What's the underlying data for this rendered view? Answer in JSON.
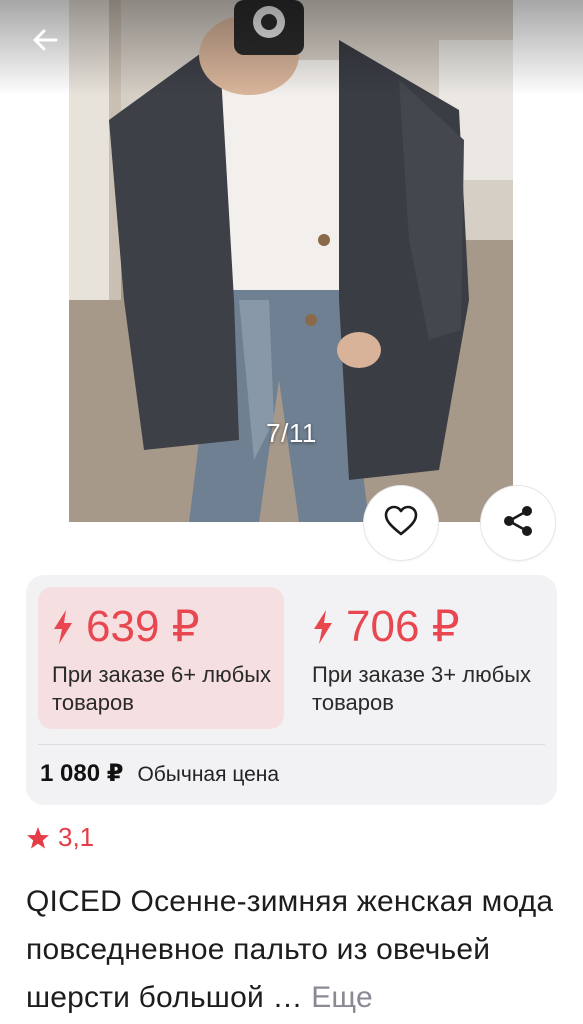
{
  "gallery": {
    "counter": "7/11"
  },
  "price_card": {
    "offers": [
      {
        "price": "639 ₽",
        "note": "При заказе 6+ любых товаров",
        "selected": true
      },
      {
        "price": "706 ₽",
        "note": "При заказе 3+ любых товаров",
        "selected": false
      }
    ],
    "regular_price": "1 080 ₽",
    "regular_label": "Обычная цена"
  },
  "rating": {
    "value": "3,1"
  },
  "product": {
    "title": "QICED Осенне-зимняя женская мода повседневное пальто из овечьей шерсти большой …",
    "more_label": "Еще"
  },
  "icons": {
    "back": "arrow-left-icon",
    "favorite": "heart-icon",
    "share": "share-icon",
    "bolt": "lightning-icon",
    "star": "star-icon"
  },
  "colors": {
    "accent_red": "#e8474f",
    "offer_selected_bg": "#f6dfe1",
    "card_bg": "#f2f2f5",
    "muted_text": "#8a8a95"
  }
}
